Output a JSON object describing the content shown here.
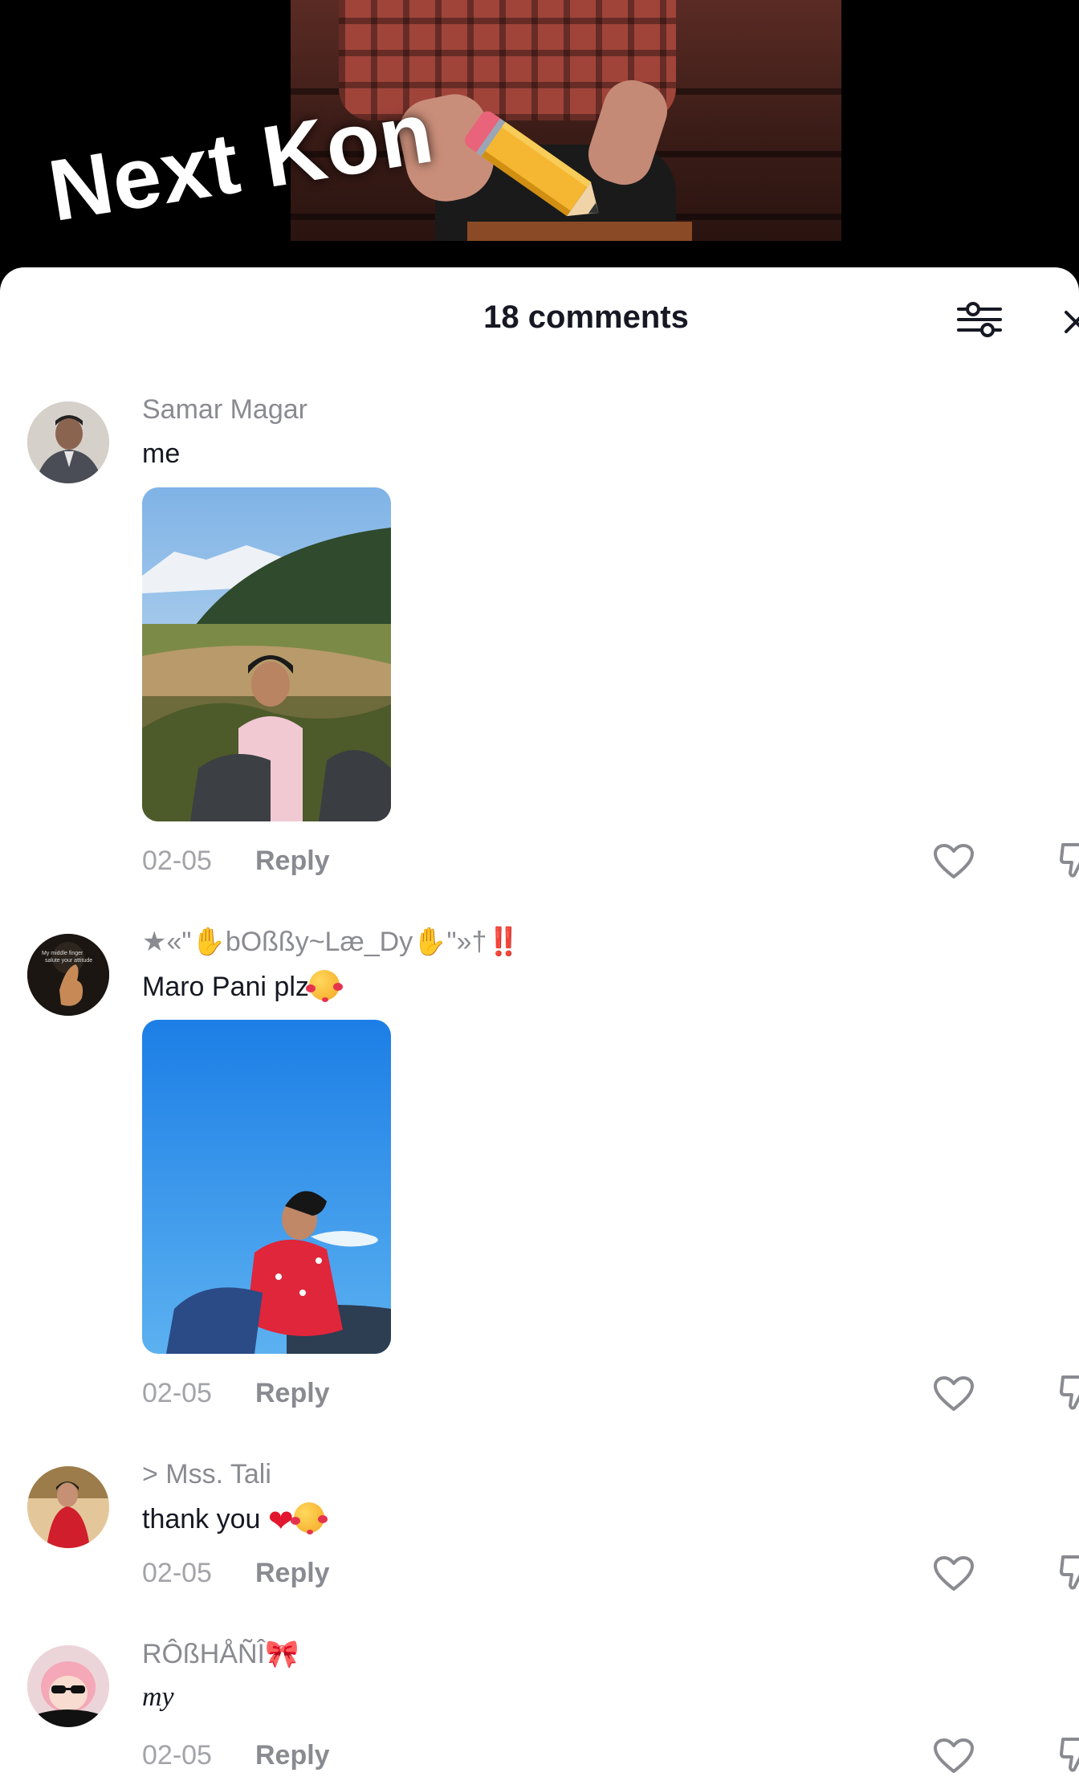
{
  "video": {
    "overlay_title": "Next Kon"
  },
  "sheet": {
    "comment_count": "18 comments",
    "filter_icon": "filter-sliders-icon",
    "close_icon": "close-x-icon"
  },
  "comments": [
    {
      "username": "Samar Magar",
      "text": "me",
      "date": "02-05",
      "reply": "Reply",
      "has_photo": true
    },
    {
      "username_prefix": "★«\"",
      "username_core": "bOßßy~Læ_Dy",
      "username_suffix": "\"»†",
      "username_bang": "‼️",
      "text": "Maro Pani plz",
      "date": "02-05",
      "reply": "Reply",
      "has_photo": true
    },
    {
      "username": "> Mss. Tali",
      "text": "thank you",
      "date": "02-05",
      "reply": "Reply",
      "has_photo": false
    },
    {
      "username": "RÔßHÅÑÎ",
      "text": "my",
      "date": "02-05",
      "reply": "Reply",
      "has_photo": false
    }
  ],
  "icons": {
    "like": "heart-outline-icon",
    "dislike": "thumbs-down-outline-icon"
  },
  "colors": {
    "username": "#8a8b91",
    "text": "#161823",
    "meta": "#a3a4a9",
    "sheet_bg": "#ffffff"
  }
}
